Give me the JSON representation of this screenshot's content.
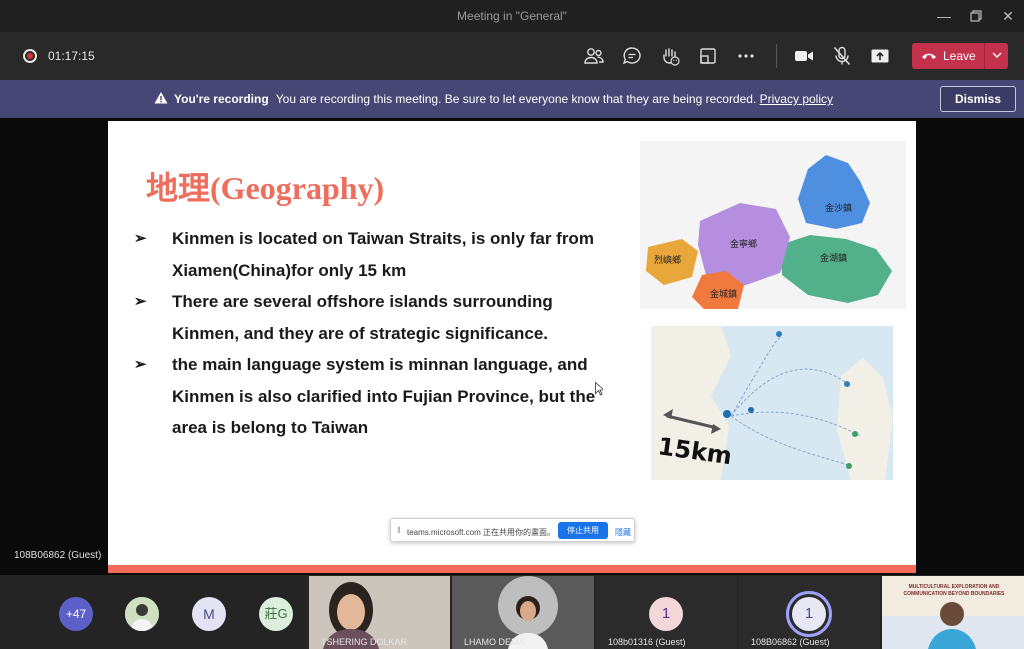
{
  "window": {
    "title": "Meeting in \"General\""
  },
  "meeting": {
    "timer": "01:17:15",
    "leave_label": "Leave"
  },
  "banner": {
    "bold": "You're recording",
    "message": "You are recording this meeting. Be sure to let everyone know that they are being recorded.",
    "link": "Privacy policy",
    "dismiss_label": "Dismiss"
  },
  "slide": {
    "title": "地理(Geography)",
    "bullets": [
      {
        "text": "Kinmen is located on Taiwan Straits, is only far from Xiamen(China)for only 15 km"
      },
      {
        "text": "There are several offshore islands surrounding Kinmen, and they are of strategic significance."
      },
      {
        "text": "the main language system is minnan language, and Kinmen is also clarified into Fujian Province, but the area is belong to Taiwan"
      }
    ],
    "map_top_labels": [
      "金沙鎮",
      "金寧鄉",
      "金湖鎮",
      "烈嶼鄉",
      "金城鎮"
    ],
    "map_bottom_label": "15km"
  },
  "presenter_label": "108B06862 (Guest)",
  "share_toast": {
    "text": "teams.microsoft.com 正在共用你的畫面。",
    "stop_label": "停止共用",
    "hide_label": "隱藏"
  },
  "participants": {
    "more_count": "+47",
    "avatars": [
      {
        "initial": "M"
      },
      {
        "initial": "莊G"
      }
    ],
    "tiles": [
      {
        "name": "TSHERING DOLKAR"
      },
      {
        "name": "LHAMO DEMA"
      },
      {
        "name": "108b01316 (Guest)",
        "badge": "1"
      },
      {
        "name": "108B06862 (Guest)",
        "badge": "1"
      }
    ],
    "poster_text": "MULTICULTURAL EXPLORATION AND COMMUNICATION BEYOND BOUNDARIES"
  },
  "colors": {
    "accent": "#464775",
    "leave": "#c4314b",
    "slide_title": "#ee6e5d",
    "share_blue": "#1a73e8"
  }
}
